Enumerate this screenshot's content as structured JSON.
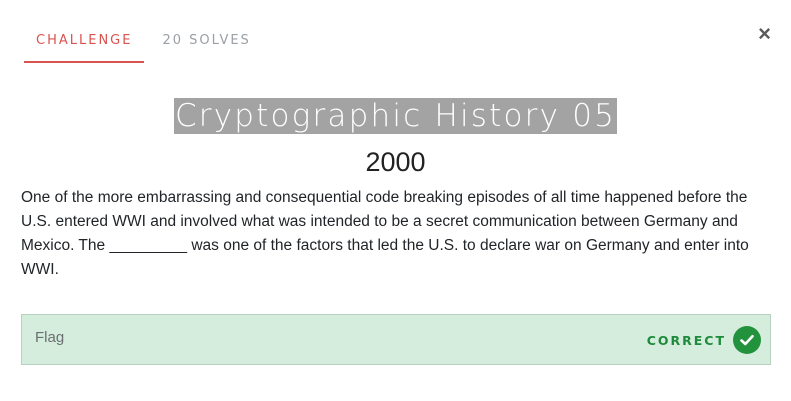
{
  "tabs": {
    "challenge_label": "CHALLENGE",
    "solves_label": "20 SOLVES"
  },
  "close_icon": "×",
  "challenge": {
    "title": "Cryptographic History 05",
    "points": "2000",
    "description": "One of the more embarrassing and consequential code breaking episodes of all time happened before the U.S. entered WWI and involved what was intended to be a secret communication between Germany and Mexico. The _________ was one of the factors that led the U.S. to declare war on Germany and enter into WWI."
  },
  "flag": {
    "placeholder": "Flag",
    "status": "CORRECT",
    "status_icon": "check-circle-icon"
  },
  "colors": {
    "accent": "#d9534f",
    "success_bg": "#d4eddc",
    "success_text": "#1e8a3b",
    "success_icon": "#23923d",
    "title_highlight": "#a3a3a3"
  }
}
